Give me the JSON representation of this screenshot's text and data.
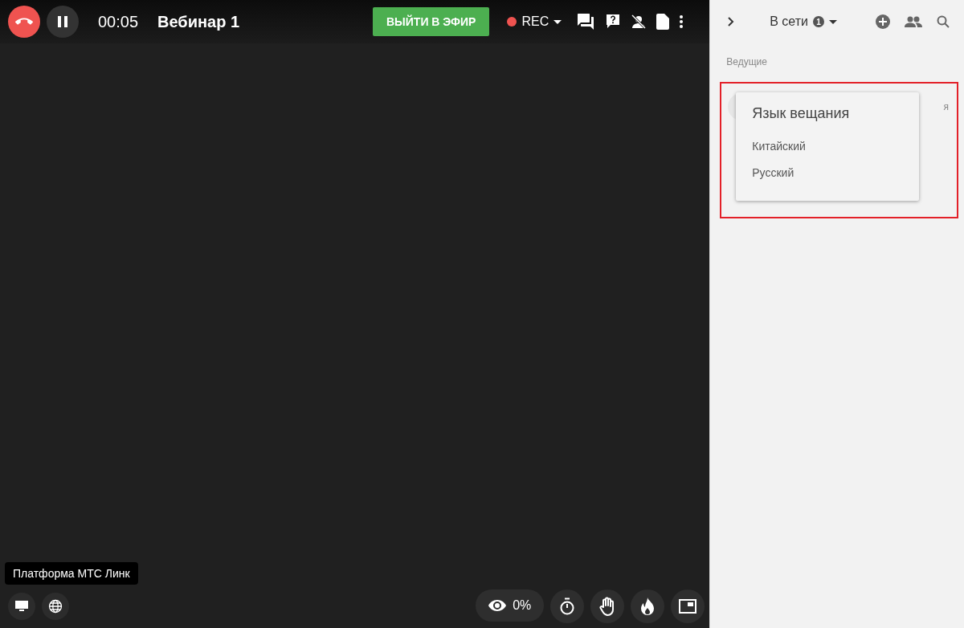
{
  "topbar": {
    "timer": "00:05",
    "title": "Вебинар 1",
    "go_live_button": "ВЫЙТИ В ЭФИР",
    "recording_label": "REC"
  },
  "stage": {
    "tooltip": "Платформа МТС Линк",
    "viewers": "0%"
  },
  "sidebar": {
    "header": "В сети",
    "online_count": "1",
    "section": "Ведущие",
    "participant_label": "я",
    "language_menu": {
      "title": "Язык вещания",
      "options": [
        "Китайский",
        "Русский"
      ]
    }
  }
}
